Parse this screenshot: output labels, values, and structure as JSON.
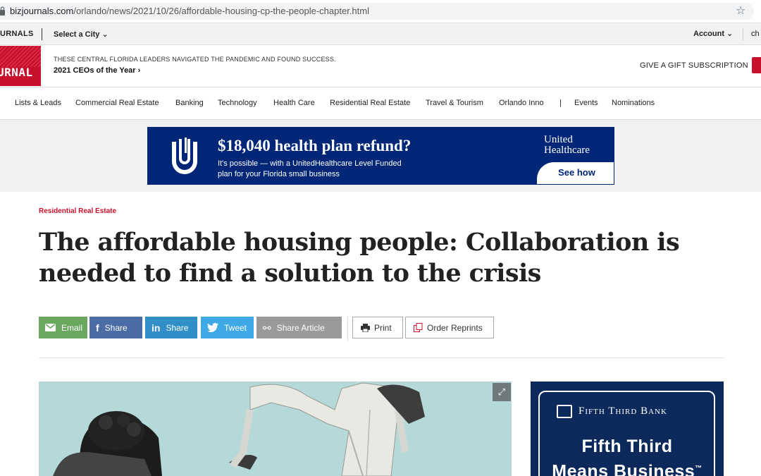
{
  "browser": {
    "url_host": "bizjournals.com",
    "url_path": "/orlando/news/2021/10/26/affordable-housing-cp-the-people-chapter.html"
  },
  "topstrip": {
    "brand": "URNALS",
    "city_select": "Select a City ⌄",
    "account": "Account ⌄",
    "ch": "ch"
  },
  "header": {
    "logo_word": "URNAL",
    "promo_small": "These Central Florida leaders navigated the pandemic and found success.",
    "promo_link": "2021 CEOs of the Year ›",
    "gift": "GIVE A GIFT SUBSCRIPTION"
  },
  "nav": {
    "items": [
      "Lists & Leads",
      "Commercial Real Estate",
      "Banking",
      "Technology",
      "Health Care",
      "Residential Real Estate",
      "Travel & Tourism",
      "Orlando Inno",
      "|",
      "Events",
      "Nominations"
    ]
  },
  "top_ad": {
    "headline": "$18,040 health plan refund?",
    "sub_line1": "It's possible — with a UnitedHealthcare Level Funded",
    "sub_line2": "plan for your Florida small business",
    "brand_line1": "United",
    "brand_line2": "Healthcare",
    "cta": "See how",
    "bg_color": "#002677"
  },
  "article": {
    "category": "Residential Real Estate",
    "headline": "The affordable housing people: Collaboration is needed to find a solution to the crisis"
  },
  "share": {
    "email": "Email",
    "facebook": "Share",
    "linkedin": "Share",
    "twitter": "Tweet",
    "share_article": "Share Article",
    "print": "Print",
    "reprints": "Order Reprints"
  },
  "side_ad": {
    "bank_name": "Fifth Third Bank",
    "tagline_line1": "Fifth Third",
    "tagline_line2": "Means Business",
    "tm": "™",
    "bg_color": "#0b2a5b"
  },
  "colors": {
    "accent": "#c8102e",
    "email": "#6aa85f",
    "facebook": "#4c6ca8",
    "linkedin": "#2f8fc6",
    "twitter": "#3fa9e6"
  }
}
